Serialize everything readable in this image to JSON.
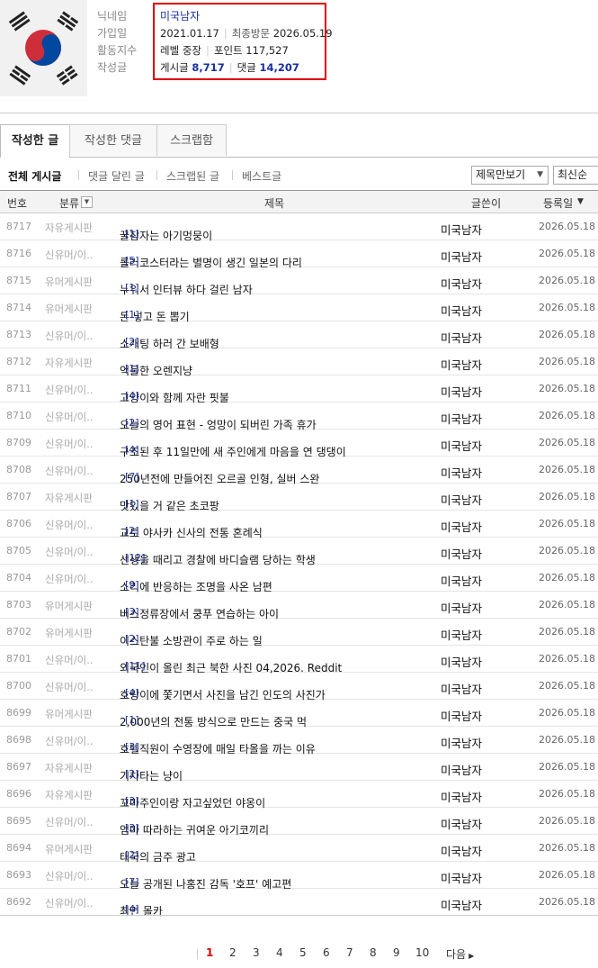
{
  "profile": {
    "labels": [
      "닉네임",
      "가입일",
      "활동지수",
      "작성글"
    ],
    "nickname": "미국남자",
    "join_date": "2021.01.17",
    "last_visit_label": "최종방문",
    "last_visit": "2026.05.19",
    "level": "레벨 중장",
    "points": "포인트 117,527",
    "posts_label": "게시글",
    "posts_count": "8,717",
    "comments_label": "댓글",
    "comments_count": "14,207",
    "avatar_icon": "korean-flag-icon"
  },
  "tabs": [
    "작성한 글",
    "작성한 댓글",
    "스크랩함"
  ],
  "filters": [
    "전체 게시글",
    "댓글 달린 글",
    "스크랩된 글",
    "베스트글"
  ],
  "view_select": "제목만보기",
  "sort_select": "최신순",
  "columns": {
    "num": "번호",
    "cat": "분류",
    "title": "제목",
    "author": "글쓴이",
    "date": "등록일"
  },
  "rows": [
    {
      "num": "8717",
      "cat": "자유게시판",
      "title": "꿀잠자는 아기멍뭉이",
      "comments": "[1]",
      "author": "미국남자",
      "date": "2026.05.18"
    },
    {
      "num": "8716",
      "cat": "신유머/이..",
      "title": "롤러코스터라는 별명이 생긴 일본의 다리",
      "comments": "[5]",
      "author": "미국남자",
      "date": "2026.05.18"
    },
    {
      "num": "8715",
      "cat": "유머게시판",
      "title": "누워서 인터뷰 하다 걸린 남자",
      "comments": "[1]",
      "author": "미국남자",
      "date": "2026.05.18"
    },
    {
      "num": "8714",
      "cat": "유머게시판",
      "title": "돈 넣고 돈 뽑기",
      "comments": "[1]",
      "author": "미국남자",
      "date": "2026.05.18"
    },
    {
      "num": "8713",
      "cat": "신유머/이..",
      "title": "소개팅 하러 간 보배형",
      "comments": "[2]",
      "author": "미국남자",
      "date": "2026.05.18"
    },
    {
      "num": "8712",
      "cat": "자유게시판",
      "title": "억울한 오렌지냥",
      "comments": "[1]",
      "author": "미국남자",
      "date": "2026.05.18"
    },
    {
      "num": "8711",
      "cat": "신유머/이..",
      "title": "고양이와 함께 자란 핏불",
      "comments": "[4]",
      "author": "미국남자",
      "date": "2026.05.18"
    },
    {
      "num": "8710",
      "cat": "신유머/이..",
      "title": "오늘의 영어 표현 - 엉망이 되버린 가족 휴가",
      "comments": "[2]",
      "author": "미국남자",
      "date": "2026.05.18"
    },
    {
      "num": "8709",
      "cat": "신유머/이..",
      "title": "구조된 후 11일만에 새 주인에게 마음을 연 댕댕이",
      "comments": "[4]",
      "author": "미국남자",
      "date": "2026.05.18"
    },
    {
      "num": "8708",
      "cat": "신유머/이..",
      "title": "250년전에 만들어진 오르골 인형, 실버 스완",
      "comments": "[7]",
      "author": "미국남자",
      "date": "2026.05.18"
    },
    {
      "num": "8707",
      "cat": "자유게시판",
      "title": "맛있을 거 같은 초코팡",
      "comments": "[1]",
      "author": "미국남자",
      "date": "2026.05.18"
    },
    {
      "num": "8706",
      "cat": "신유머/이..",
      "title": "교토 야사카 신사의 전통 혼례식",
      "comments": "[2]",
      "author": "미국남자",
      "date": "2026.05.18"
    },
    {
      "num": "8705",
      "cat": "신유머/이..",
      "title": "선생을 때리고 경찰에 바디슬램 당하는 학생",
      "comments": "[12]",
      "author": "미국남자",
      "date": "2026.05.18"
    },
    {
      "num": "8704",
      "cat": "신유머/이..",
      "title": "소리에 반응하는 조명을 사온 남편",
      "comments": "[9]",
      "author": "미국남자",
      "date": "2026.05.18"
    },
    {
      "num": "8703",
      "cat": "유머게시판",
      "title": "버스정류장에서 쿵푸 연습하는 아이",
      "comments": "[3]",
      "author": "미국남자",
      "date": "2026.05.18"
    },
    {
      "num": "8702",
      "cat": "유머게시판",
      "title": "이스탄불 소방관이 주로 하는 일",
      "comments": "[2]",
      "author": "미국남자",
      "date": "2026.05.18"
    },
    {
      "num": "8701",
      "cat": "신유머/이..",
      "title": "외국인이 올린 최근 북한 사진 04,2026. Reddit",
      "comments": "[11]",
      "author": "미국남자",
      "date": "2026.05.18"
    },
    {
      "num": "8700",
      "cat": "신유머/이..",
      "title": "호랑이에 쫓기면서 사진을 남긴 인도의 사진가",
      "comments": "[4]",
      "author": "미국남자",
      "date": "2026.05.18"
    },
    {
      "num": "8699",
      "cat": "유머게시판",
      "title": "2,000년의 전통 방식으로 만드는 중국 먹",
      "comments": "[1]",
      "author": "미국남자",
      "date": "2026.05.18"
    },
    {
      "num": "8698",
      "cat": "신유머/이..",
      "title": "호텔직원이 수영장에 매일 타올을 까는 이유",
      "comments": "[3]",
      "author": "미국남자",
      "date": "2026.05.18"
    },
    {
      "num": "8697",
      "cat": "자유게시판",
      "title": "기차타는 냥이",
      "comments": "[2]",
      "author": "미국남자",
      "date": "2026.05.18"
    },
    {
      "num": "8696",
      "cat": "자유게시판",
      "title": "꼬마주인이랑 자고싶었던 야옹이",
      "comments": "[3]",
      "author": "미국남자",
      "date": "2026.05.18"
    },
    {
      "num": "8695",
      "cat": "신유머/이..",
      "title": "엄마 따라하는 귀여운 아기코끼리",
      "comments": "[3]",
      "author": "미국남자",
      "date": "2026.05.18"
    },
    {
      "num": "8694",
      "cat": "유머게시판",
      "title": "태국의 금주 광고",
      "comments": "[2]",
      "author": "미국남자",
      "date": "2026.05.18"
    },
    {
      "num": "8693",
      "cat": "신유머/이..",
      "title": "오늘 공개된 나홍진 감독 '호프' 예고편",
      "comments": "[7]",
      "author": "미국남자",
      "date": "2026.05.18"
    },
    {
      "num": "8692",
      "cat": "신유머/이..",
      "title": "최면 몰카",
      "comments": "[4]",
      "author": "미국남자",
      "date": "2026.05.18"
    }
  ],
  "pagination": {
    "pages": [
      "1",
      "2",
      "3",
      "4",
      "5",
      "6",
      "7",
      "8",
      "9",
      "10"
    ],
    "current": "1",
    "next": "다음"
  }
}
